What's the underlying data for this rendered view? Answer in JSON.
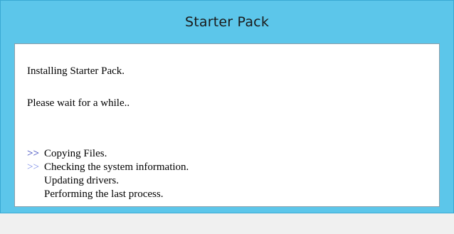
{
  "window": {
    "title": "Starter Pack"
  },
  "content": {
    "heading": "Installing Starter Pack.",
    "message": "Please wait for a while..",
    "steps": [
      {
        "label": "Copying Files.",
        "marker": ">>",
        "status": "done"
      },
      {
        "label": "Checking the system information.",
        "marker": ">>",
        "status": "current"
      },
      {
        "label": "Updating drivers.",
        "marker": "",
        "status": "pending"
      },
      {
        "label": "Performing the last process.",
        "marker": "",
        "status": "pending"
      }
    ]
  },
  "colors": {
    "titlebar": "#5cc6ea",
    "marker_done": "#1f2fb5",
    "marker_current": "#7d8ee8"
  }
}
